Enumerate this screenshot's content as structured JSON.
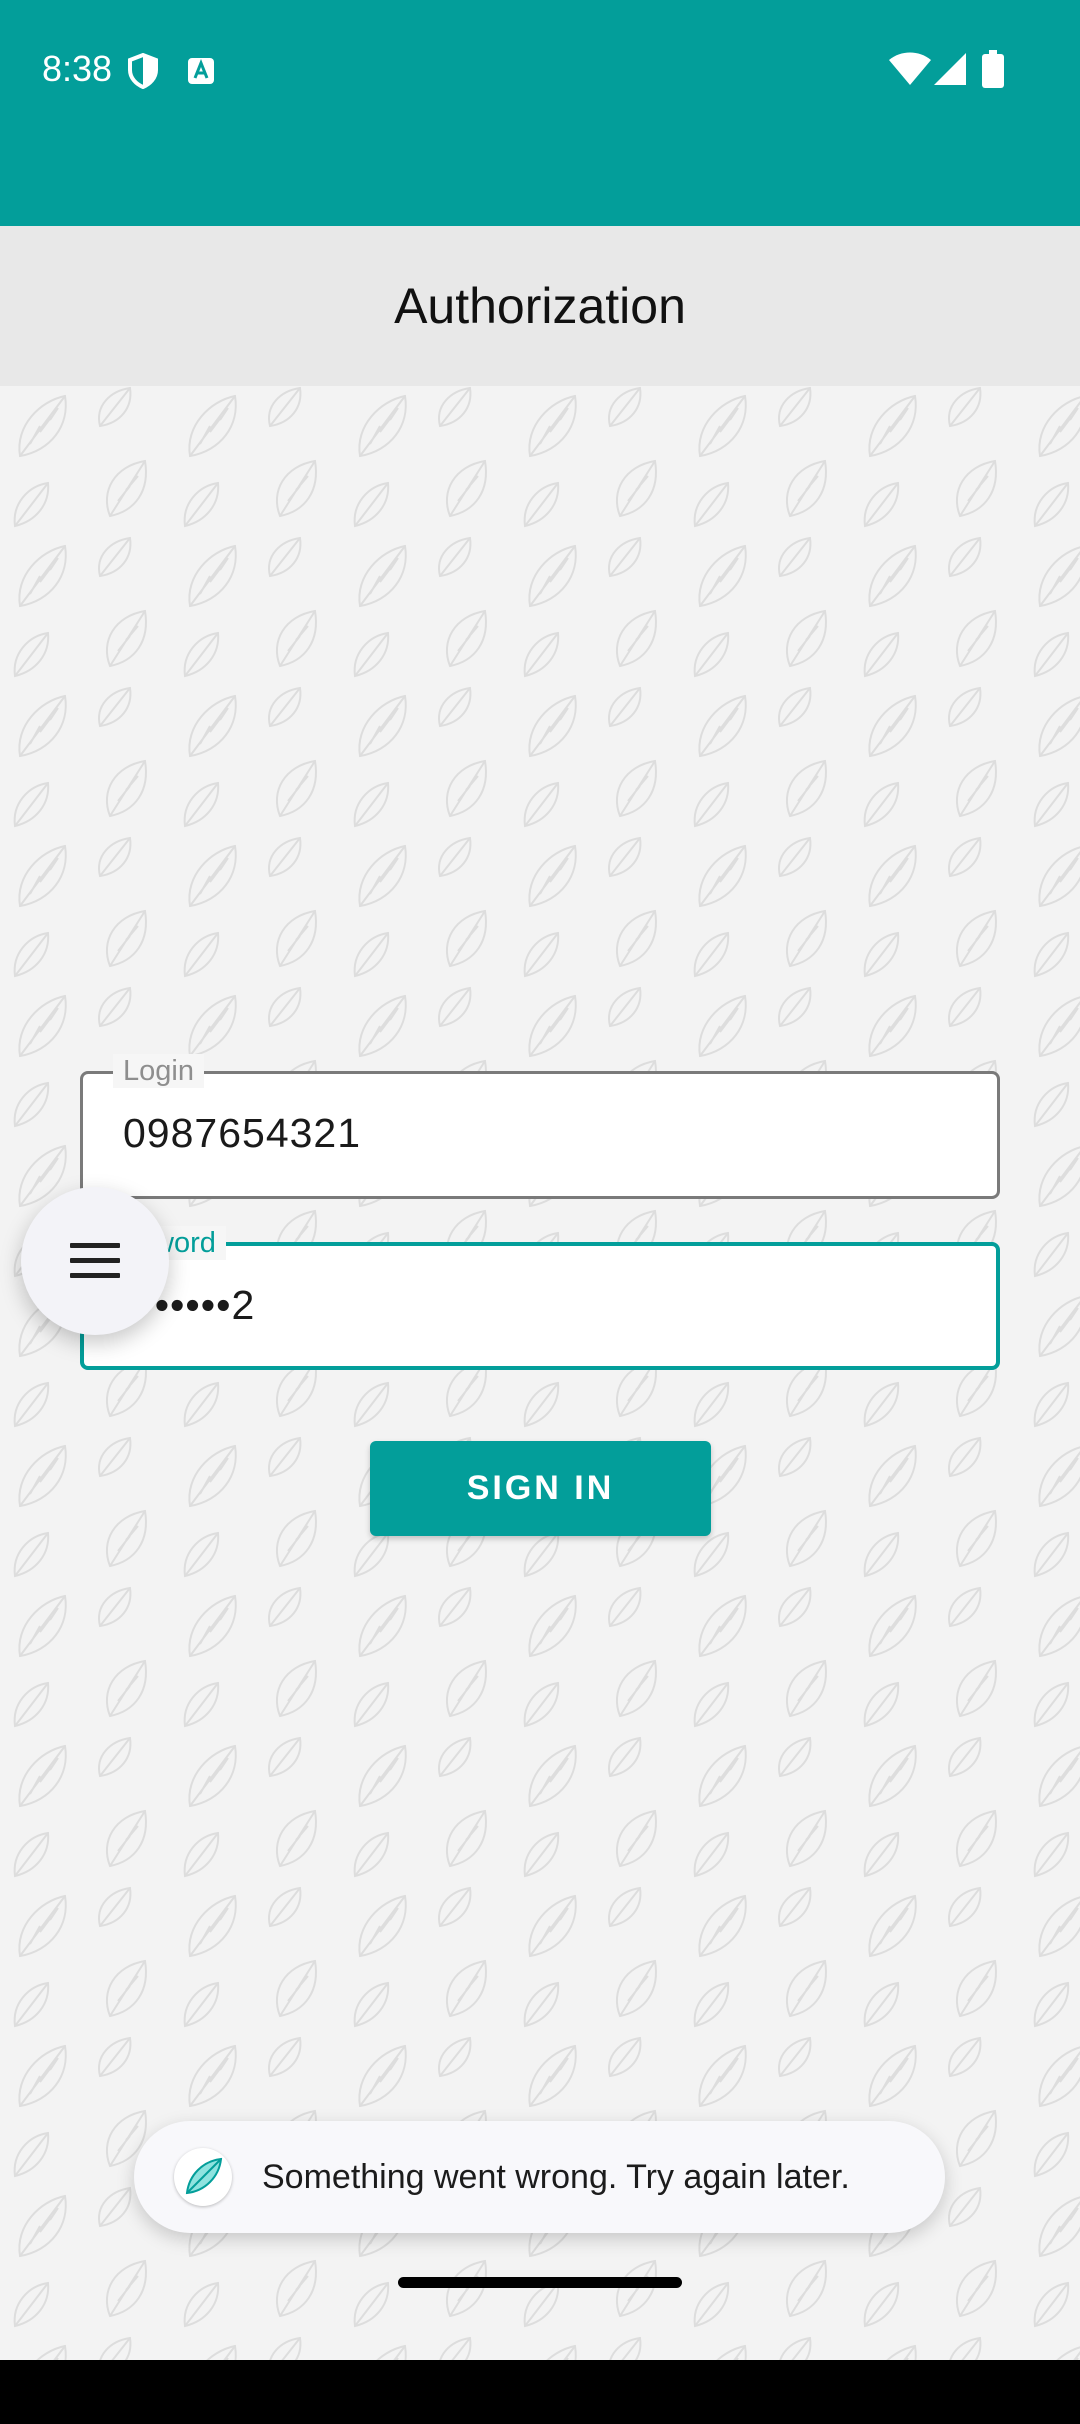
{
  "status_bar": {
    "time": "8:38",
    "icons": [
      "shield-icon",
      "text-a-icon",
      "wifi-icon",
      "signal-icon",
      "battery-icon"
    ]
  },
  "app_bar": {
    "title": "Authorization"
  },
  "form": {
    "login": {
      "label": "Login",
      "value": "0987654321"
    },
    "password": {
      "label": "ssword",
      "value": "•••••••2"
    },
    "sign_in_label": "SIGN IN"
  },
  "toast": {
    "message": "Something went wrong. Try again later."
  },
  "colors": {
    "accent": "#039e9a",
    "app_bar": "#e8e8e8",
    "background": "#f3f3f3"
  }
}
